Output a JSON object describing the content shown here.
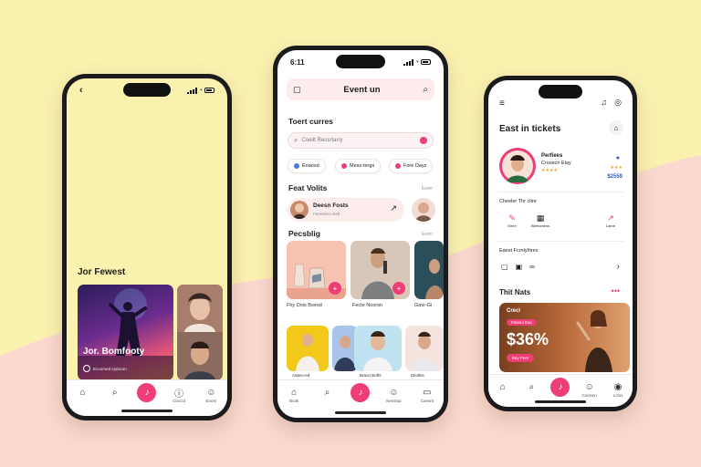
{
  "colors": {
    "accent": "#ef3d76",
    "background": "#fbf2b0",
    "wave": "#fbd9cf"
  },
  "phone1": {
    "status_time": "",
    "section_title": "Jor Fewest",
    "featured_title": "Jor. Bomfooty",
    "featured_caption": "Ecoomed ejoiscon",
    "tabs": [
      "",
      "",
      "",
      "Cioccd",
      "Eoors"
    ]
  },
  "phone2": {
    "status_time": "6:11",
    "title": "Event un",
    "section1": "Toert curres",
    "search_placeholder": "Coeilt Reosrtarry",
    "chips": [
      "Eoaosd",
      "Mess-tergs",
      "Fore Dayz"
    ],
    "section2": "Feat Volits",
    "section2_seeall": "Eerer",
    "event_name": "Deesn Fosts",
    "event_sub": "Fereeeiso-Bstl",
    "section3": "Pecsblig",
    "section3_seeall": "Eerer",
    "card_labels": [
      "Fhy Dois Boesd",
      "Fecte Noorsn",
      "Gavr-Gi"
    ],
    "grid_labels": [
      "Adaso-ed",
      "",
      "Braun Bofts",
      "Ebolles"
    ],
    "tabs": [
      "Bcak",
      "",
      "",
      "Nesstop",
      "Coesrit"
    ]
  },
  "phone3": {
    "title": "East in tickets",
    "profile_name": "Perfiees",
    "profile_sub": "Crosecn Elay",
    "rating": "★★★★",
    "rating_right": "★★★",
    "price": "$2559",
    "section1": "Cheeler Thr citre",
    "actions": [
      "Eiere",
      "Bietroniens",
      "Lame"
    ],
    "section2": "Eaest Fcrnly/tires",
    "section3": "Thit Nats",
    "promo_chip1": "Crecl",
    "promo_chip2": "Fetesd Eas",
    "promo_percent": "$36%",
    "promo_button": "Bay Feer",
    "tabs": [
      "",
      "",
      "",
      "Coissen",
      "Lctos"
    ]
  }
}
